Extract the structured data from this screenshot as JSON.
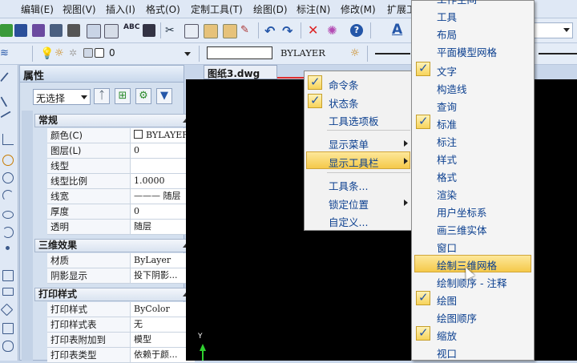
{
  "menubar": {
    "items": [
      "编辑(E)",
      "视图(V)",
      "插入(I)",
      "格式(O)",
      "定制工具(T)",
      "绘图(D)",
      "标注(N)",
      "修改(M)",
      "扩展工"
    ]
  },
  "toolbar2": {
    "layer_value": "0",
    "linetype_value": "BYLAYER"
  },
  "properties": {
    "title": "属性",
    "selection": "无选择",
    "sections": [
      {
        "title": "常规",
        "rows": [
          {
            "key": "颜色(C)",
            "value": "BYLAYER"
          },
          {
            "key": "图层(L)",
            "value": "0"
          },
          {
            "key": "线型",
            "value": ""
          },
          {
            "key": "线型比例",
            "value": "1.0000"
          },
          {
            "key": "线宽",
            "value": "——— 随层"
          },
          {
            "key": "厚度",
            "value": "0"
          },
          {
            "key": "透明",
            "value": "随层"
          }
        ]
      },
      {
        "title": "三维效果",
        "rows": [
          {
            "key": "材质",
            "value": "ByLayer"
          },
          {
            "key": "阴影显示",
            "value": "投下阴影..."
          }
        ]
      },
      {
        "title": "打印样式",
        "rows": [
          {
            "key": "打印样式",
            "value": "ByColor"
          },
          {
            "key": "打印样式表",
            "value": "无"
          },
          {
            "key": "打印表附加到",
            "value": "模型"
          },
          {
            "key": "打印表类型",
            "value": "依赖于颜..."
          }
        ]
      }
    ]
  },
  "drawing": {
    "tab_title": "图纸3.dwg",
    "axis_y_label": "Y"
  },
  "context_menu": {
    "items": [
      {
        "label": "命令条",
        "checked": true
      },
      {
        "label": "状态条",
        "checked": true
      },
      {
        "label": "工具选项板",
        "checked": false
      },
      {
        "label": "显示菜单",
        "checked": false,
        "submenu": true
      },
      {
        "label": "显示工具栏",
        "checked": false,
        "submenu": true,
        "highlighted": true
      },
      {
        "label": "工具条...",
        "checked": false
      },
      {
        "label": "锁定位置",
        "checked": false,
        "submenu": true
      },
      {
        "label": "自定义...",
        "checked": false
      }
    ]
  },
  "toolbar_submenu": {
    "items": [
      {
        "label": "工作空间",
        "checked": false
      },
      {
        "label": "工具",
        "checked": false
      },
      {
        "label": "布局",
        "checked": false
      },
      {
        "label": "平面模型网格",
        "checked": false
      },
      {
        "label": "文字",
        "checked": true
      },
      {
        "label": "构造线",
        "checked": false
      },
      {
        "label": "查询",
        "checked": false
      },
      {
        "label": "标准",
        "checked": true
      },
      {
        "label": "标注",
        "checked": false
      },
      {
        "label": "样式",
        "checked": false
      },
      {
        "label": "格式",
        "checked": false
      },
      {
        "label": "渲染",
        "checked": false
      },
      {
        "label": "用户坐标系",
        "checked": false
      },
      {
        "label": "画三维实体",
        "checked": false
      },
      {
        "label": "窗口",
        "checked": false
      },
      {
        "label": "绘制三维网格",
        "checked": false,
        "highlighted": true
      },
      {
        "label": "绘制顺序 - 注释",
        "checked": false
      },
      {
        "label": "绘图",
        "checked": true
      },
      {
        "label": "绘图顺序",
        "checked": false
      },
      {
        "label": "缩放",
        "checked": true
      },
      {
        "label": "视口",
        "checked": false
      }
    ]
  },
  "colors": {
    "highlight_bg": "#f7d35a",
    "menu_text": "#0b3f8f",
    "canvas_bg": "#000000"
  }
}
